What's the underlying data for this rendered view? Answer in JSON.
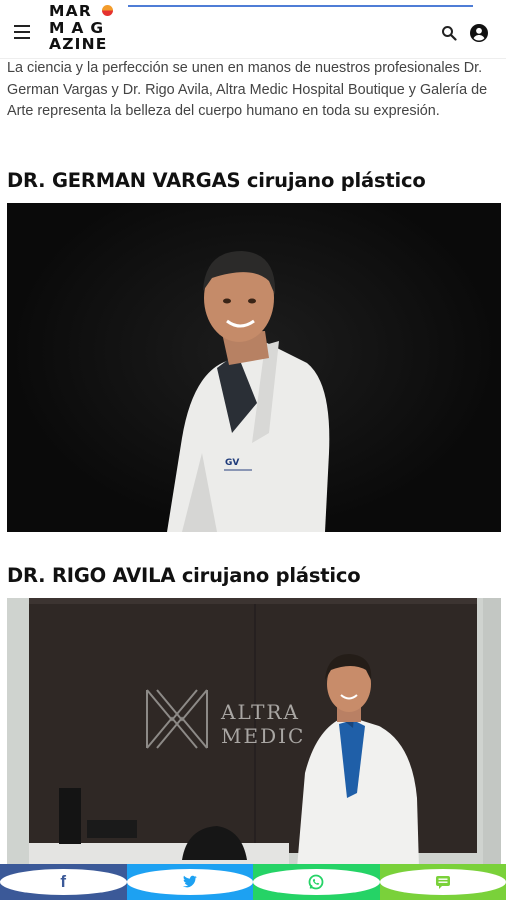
{
  "header": {
    "logo_lines": [
      "MAR",
      "MAG",
      "AZINE"
    ],
    "menu_icon": "hamburger-menu-icon",
    "search_icon": "search-icon",
    "account_icon": "user-account-icon"
  },
  "article": {
    "intro": "La ciencia y la perfección se unen en manos de nuestros profesionales Dr. German Vargas y Dr. Rigo Avila, Altra Medic Hospital Boutique y Galería de Arte representa la belleza del cuerpo humano en toda su expresión.",
    "sections": [
      {
        "heading": "DR. GERMAN VARGAS cirujano plástico",
        "photo_logo": "GV"
      },
      {
        "heading": "DR. RIGO AVILA cirujano plástico",
        "sign_line1": "ALTRA",
        "sign_line2": "MEDIC"
      }
    ]
  },
  "share_bar": {
    "buttons": [
      {
        "name": "facebook",
        "icon": "facebook-icon",
        "color": "#3b5998"
      },
      {
        "name": "twitter",
        "icon": "twitter-icon",
        "color": "#1da1f2"
      },
      {
        "name": "whatsapp",
        "icon": "whatsapp-icon",
        "color": "#25d366"
      },
      {
        "name": "sms",
        "icon": "message-icon",
        "color": "#7ad13a"
      }
    ]
  }
}
